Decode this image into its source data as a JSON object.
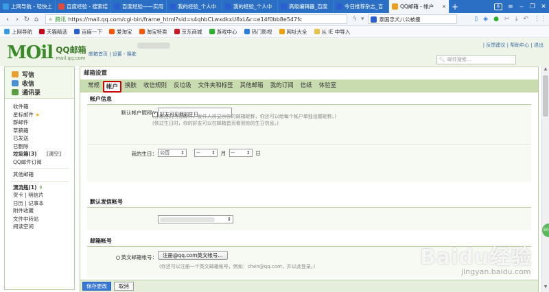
{
  "browser": {
    "tabs": [
      {
        "title": "上网导航 - 轻快上",
        "color": "#3a9be0"
      },
      {
        "title": "百度经验 - 搜索结",
        "color": "#e24a3b"
      },
      {
        "title": "百度经验——实用",
        "color": "#2b5fd0"
      },
      {
        "title": "我的经验_个人中",
        "color": "#2b5fd0"
      },
      {
        "title": "我的经验_个人中",
        "color": "#2b5fd0"
      },
      {
        "title": "高级编辑器_百度",
        "color": "#2b5fd0"
      },
      {
        "title": "今日推荐杂志_百",
        "color": "#2b5fd0"
      },
      {
        "title": "QQ邮箱 - 帐户",
        "color": "#e9a020"
      }
    ],
    "tab_count": "8",
    "url_hint": "腾讯",
    "url": "https://mail.qq.com/cgi-bin/frame_html?sid=s4qhbCLwxdkxU8xL&r=e14f0bb8e547fc",
    "search_text": "泰国忠犬八公被撞",
    "bookmarks": [
      {
        "label": "上网导航",
        "color": "#3a9be0"
      },
      {
        "label": "天猫精选",
        "color": "#d0021b"
      },
      {
        "label": "百度一下",
        "color": "#2b5fd0"
      },
      {
        "label": "爱淘宝",
        "color": "#ff5500"
      },
      {
        "label": "淘宝特卖",
        "color": "#ff5500"
      },
      {
        "label": "京东商城",
        "color": "#c81623"
      },
      {
        "label": "游戏中心",
        "color": "#2bb02b"
      },
      {
        "label": "热门影视",
        "color": "#2b7de0"
      },
      {
        "label": "网址大全",
        "color": "#f0a000"
      },
      {
        "label": "从 IE 中导入",
        "color": "#e8c04a"
      }
    ]
  },
  "mail_header": {
    "logo_mo": "MOil",
    "logo_name": "QQ邮箱",
    "logo_domain": "mail.qq.com",
    "head_links": "邮箱首页 | 设置 - 换肤",
    "top_links": "| 反馈建议 | 帮助中心 | 退出",
    "search_placeholder": "邮件搜索..."
  },
  "sidebar": {
    "compose": [
      {
        "label": "写信",
        "color": "#e8a030"
      },
      {
        "label": "收信",
        "color": "#4a90d0"
      },
      {
        "label": "通讯录",
        "color": "#5aa040"
      }
    ],
    "folders": [
      "收件箱",
      "星标邮件",
      "群邮件",
      "草稿箱",
      "已发送",
      "已删除"
    ],
    "trash": "垃圾箱(3)",
    "trash_action": "[清空]",
    "qq_subscribe": "QQ邮件订阅",
    "other_mailbox": "其他邮箱",
    "drift_bottle": "漂流瓶(1)",
    "extra_links": [
      "贺卡 | 明信片",
      "日历 | 记事本",
      "附件收藏",
      "文件中转站",
      "阅读空间"
    ]
  },
  "main": {
    "title": "邮箱设置",
    "tabs": [
      "常规",
      "帐户",
      "换肤",
      "收信规则",
      "反垃圾",
      "文件夹和标签",
      "其他邮箱",
      "我的订阅",
      "信纸",
      "体验室"
    ],
    "active_tab": "帐户",
    "account_info": {
      "heading": "帐户信息",
      "nickname_label": "默认帐户昵称：",
      "nickname_value": "",
      "nickname_note": "(你发出的所有邮件，发件人将显示你的邮箱昵称，你还可以给每个帐户单独设置昵称。)",
      "birthday_label": "我的生日：",
      "calendar_select": "公历",
      "month_select": "--",
      "day_select": "--",
      "month_unit": "月",
      "day_unit": "日",
      "friends_visible_label": "好友可见我的生日",
      "birthday_note": "(快过生日时，你的好友可以在邮箱首页看到你的生日信息。)"
    },
    "default_sender": {
      "heading": "默认发信帐号"
    },
    "mailbox_account": {
      "heading": "邮箱帐号",
      "english_label": "英文邮箱帐号：",
      "register_button": "注册@qq.com英文帐号...",
      "note": "(你还可以注册一个英文邮箱帐号，例如：chen@qq.com，并以此登录。)"
    },
    "save_button": "保存更改",
    "cancel_button": "取消"
  },
  "watermark": {
    "text": "Baidu经验",
    "sub": "jingyan.baidu.com"
  },
  "side_badge": "60"
}
